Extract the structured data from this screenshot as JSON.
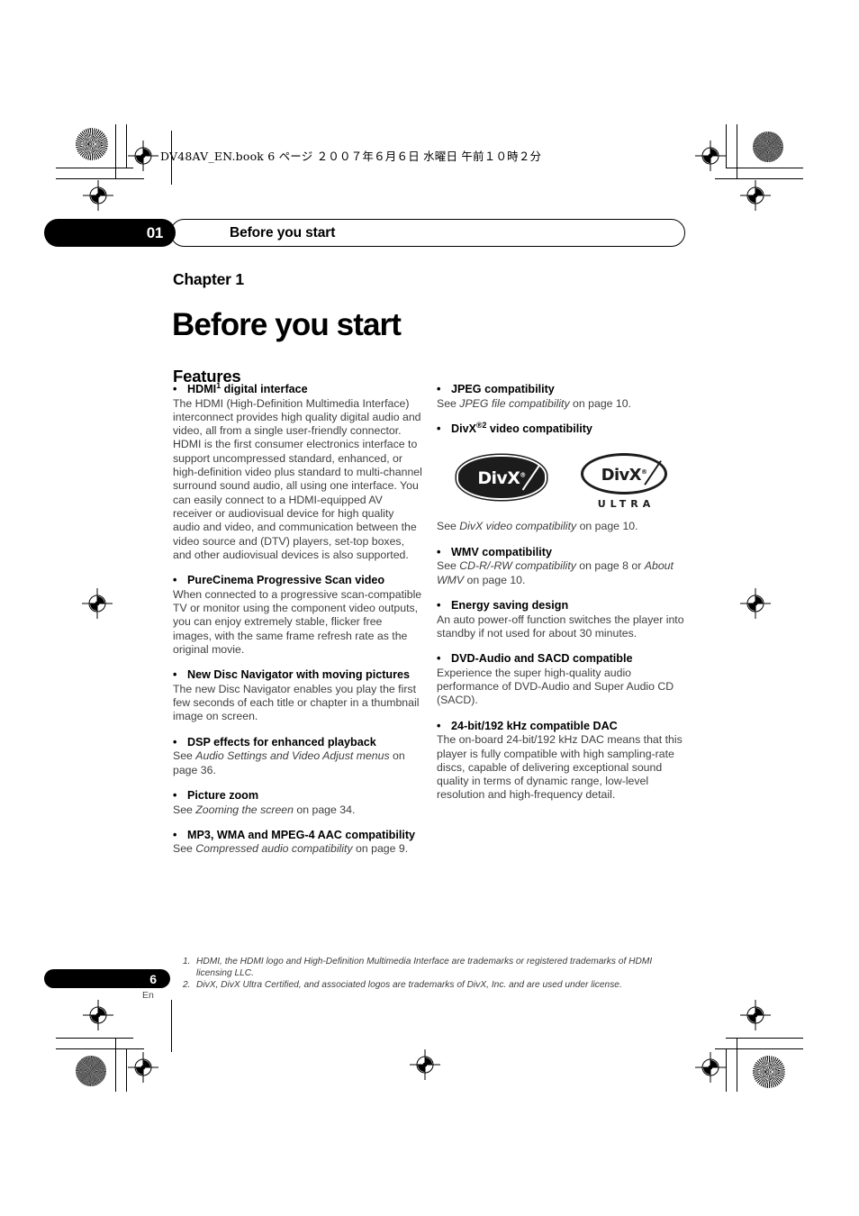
{
  "page": {
    "jp_header": "DV48AV_EN.book   6 ページ   ２００７年６月６日   水曜日   午前１０時２分",
    "footer_page_number": "6",
    "footer_language": "En"
  },
  "running_head": {
    "chapter_number": "01",
    "title": "Before you start"
  },
  "heading": {
    "chapter_label": "Chapter 1",
    "chapter_title": "Before you start",
    "section_title": "Features"
  },
  "left_column": {
    "features": [
      {
        "bullet": "•",
        "title_pre": "HDMI",
        "title_sup": "1",
        "title_post": " digital interface",
        "body": "The HDMI (High-Definition Multimedia Interface) interconnect provides high quality digital audio and video, all from a single user-friendly connector. HDMI is the first consumer electronics interface to support uncompressed standard, enhanced, or high-definition video plus standard to multi-channel surround sound audio, all using one interface. You can easily connect to a HDMI-equipped AV receiver or audiovisual device for high quality audio and video, and communication between the video source and (DTV) players, set-top boxes, and other audiovisual devices is also supported."
      },
      {
        "bullet": "•",
        "title_pre": "PureCinema Progressive Scan video",
        "title_sup": "",
        "title_post": "",
        "body": "When connected to a progressive scan-compatible TV or monitor using the component video outputs, you can enjoy extremely stable, flicker free images, with the same frame refresh rate as the original movie."
      },
      {
        "bullet": "•",
        "title_pre": "New Disc Navigator with moving pictures",
        "title_sup": "",
        "title_post": "",
        "body": "The new Disc Navigator enables you play the first few seconds of each title or chapter in a thumbnail image on screen."
      },
      {
        "bullet": "•",
        "title_pre": "DSP effects for enhanced playback",
        "title_sup": "",
        "title_post": "",
        "body_html": "See <i>Audio Settings and Video Adjust menus</i> on page 36."
      },
      {
        "bullet": "•",
        "title_pre": "Picture zoom",
        "title_sup": "",
        "title_post": "",
        "body_html": "See <i>Zooming the screen</i> on page 34."
      },
      {
        "bullet": "•",
        "title_pre": "MP3, WMA and MPEG-4 AAC compatibility",
        "title_sup": "",
        "title_post": "",
        "body_html": "See <i>Compressed audio compatibility</i> on page 9."
      }
    ]
  },
  "right_column": {
    "features": [
      {
        "bullet": "•",
        "title_pre": "JPEG compatibility",
        "title_sup": "",
        "title_post": "",
        "body_html": "See <i>JPEG file compatibility</i> on page 10."
      },
      {
        "bullet": "•",
        "title_pre": "DivX",
        "title_sup": "®2",
        "title_post": " video compatibility",
        "body_html": ""
      },
      {
        "bullet": "•",
        "title_pre": "WMV compatibility",
        "title_sup": "",
        "title_post": "",
        "body_html": "See <i>CD-R/-RW compatibility</i> on page 8 or <i>About WMV</i> on page 10."
      },
      {
        "bullet": "•",
        "title_pre": "Energy saving design",
        "title_sup": "",
        "title_post": "",
        "body": "An auto power-off function switches the player into standby if not used for about 30 minutes."
      },
      {
        "bullet": "•",
        "title_pre": "DVD-Audio and SACD compatible",
        "title_sup": "",
        "title_post": "",
        "body": "Experience the super high-quality audio performance of DVD-Audio and Super Audio CD (SACD)."
      },
      {
        "bullet": "•",
        "title_pre": "24-bit/192 kHz compatible DAC",
        "title_sup": "",
        "title_post": "",
        "body": "The on-board 24-bit/192 kHz DAC means that this player is fully compatible with high sampling-rate discs, capable of delivering exceptional sound quality in terms of dynamic range, low-level resolution and high-frequency detail."
      }
    ],
    "divx_caption": "See DivX video compatibility on page 10.",
    "divx_caption_html": "See <i>DivX video compatibility</i> on page 10.",
    "logos": {
      "solid_wordmark": "DivX",
      "solid_sup": "®",
      "outline_wordmark": "DivX",
      "outline_sup": "®",
      "ultra_label": "ULTRA"
    }
  },
  "footnotes": [
    {
      "num": "1.",
      "text": "HDMI, the HDMI logo and High-Definition Multimedia Interface are trademarks or registered trademarks of HDMI licensing LLC."
    },
    {
      "num": "2.",
      "text": "DivX, DivX Ultra Certified, and associated logos are trademarks of DivX, Inc. and are used under license."
    }
  ],
  "colors": {
    "ink": "#000000",
    "body_text": "#3e3e3e",
    "paper": "#ffffff"
  }
}
